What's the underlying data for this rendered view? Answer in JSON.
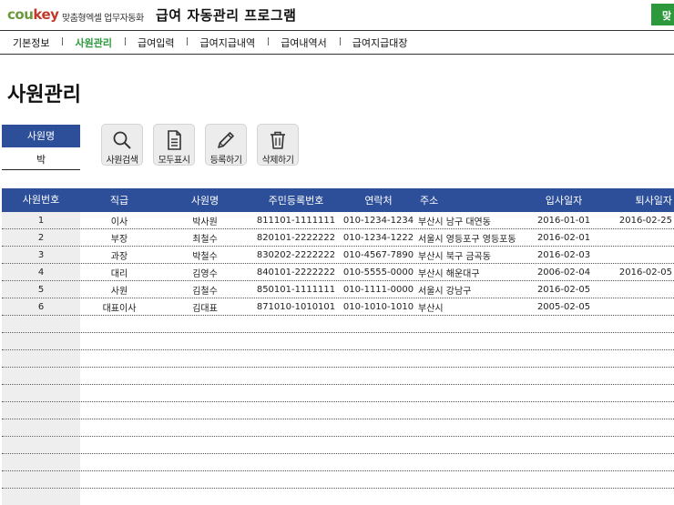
{
  "header": {
    "logo_part1": "cou",
    "logo_part2": "key",
    "logo_sub": "맞춤형엑셀 업무자동화",
    "title": "급여 자동관리 프로그램",
    "corner_button": "맞"
  },
  "nav": {
    "items": [
      {
        "label": "기본정보"
      },
      {
        "label": "사원관리"
      },
      {
        "label": "급여입력"
      },
      {
        "label": "급여지급내역"
      },
      {
        "label": "급여내역서"
      },
      {
        "label": "급여지급대장"
      }
    ],
    "active": "사원관리"
  },
  "page": {
    "title": "사원관리"
  },
  "search": {
    "label": "사원명",
    "value": "박"
  },
  "toolbar": {
    "search": {
      "label": "사원검색",
      "icon": "magnifier-icon"
    },
    "show_all": {
      "label": "모두표시",
      "icon": "document-icon"
    },
    "register": {
      "label": "등록하기",
      "icon": "pencil-icon"
    },
    "delete": {
      "label": "삭제하기",
      "icon": "trash-icon"
    }
  },
  "table": {
    "headers": {
      "no": "사원번호",
      "position": "직급",
      "name": "사원명",
      "rrn": "주민등록번호",
      "tel": "연락처",
      "addr": "주소",
      "join": "입사일자",
      "quit": "퇴사일자"
    },
    "rows": [
      {
        "no": "1",
        "position": "이사",
        "name": "박사원",
        "rrn": "811101-1111111",
        "tel": "010-1234-1234",
        "addr": "부산시 남구 대연동",
        "join": "2016-01-01",
        "quit": "2016-02-25"
      },
      {
        "no": "2",
        "position": "부장",
        "name": "최철수",
        "rrn": "820101-2222222",
        "tel": "010-1234-1222",
        "addr": "서울시 영등포구 영등포동",
        "join": "2016-02-01",
        "quit": ""
      },
      {
        "no": "3",
        "position": "과장",
        "name": "박철수",
        "rrn": "830202-2222222",
        "tel": "010-4567-7890",
        "addr": "부산시 북구 금곡동",
        "join": "2016-02-03",
        "quit": ""
      },
      {
        "no": "4",
        "position": "대리",
        "name": "김영수",
        "rrn": "840101-2222222",
        "tel": "010-5555-0000",
        "addr": "부산시 해운대구",
        "join": "2006-02-04",
        "quit": "2016-02-05"
      },
      {
        "no": "5",
        "position": "사원",
        "name": "김철수",
        "rrn": "850101-1111111",
        "tel": "010-1111-0000",
        "addr": "서울시 강남구",
        "join": "2016-02-05",
        "quit": ""
      },
      {
        "no": "6",
        "position": "대표이사",
        "name": "김대표",
        "rrn": "871010-1010101",
        "tel": "010-1010-1010",
        "addr": "부산시",
        "join": "2005-02-05",
        "quit": ""
      }
    ]
  }
}
